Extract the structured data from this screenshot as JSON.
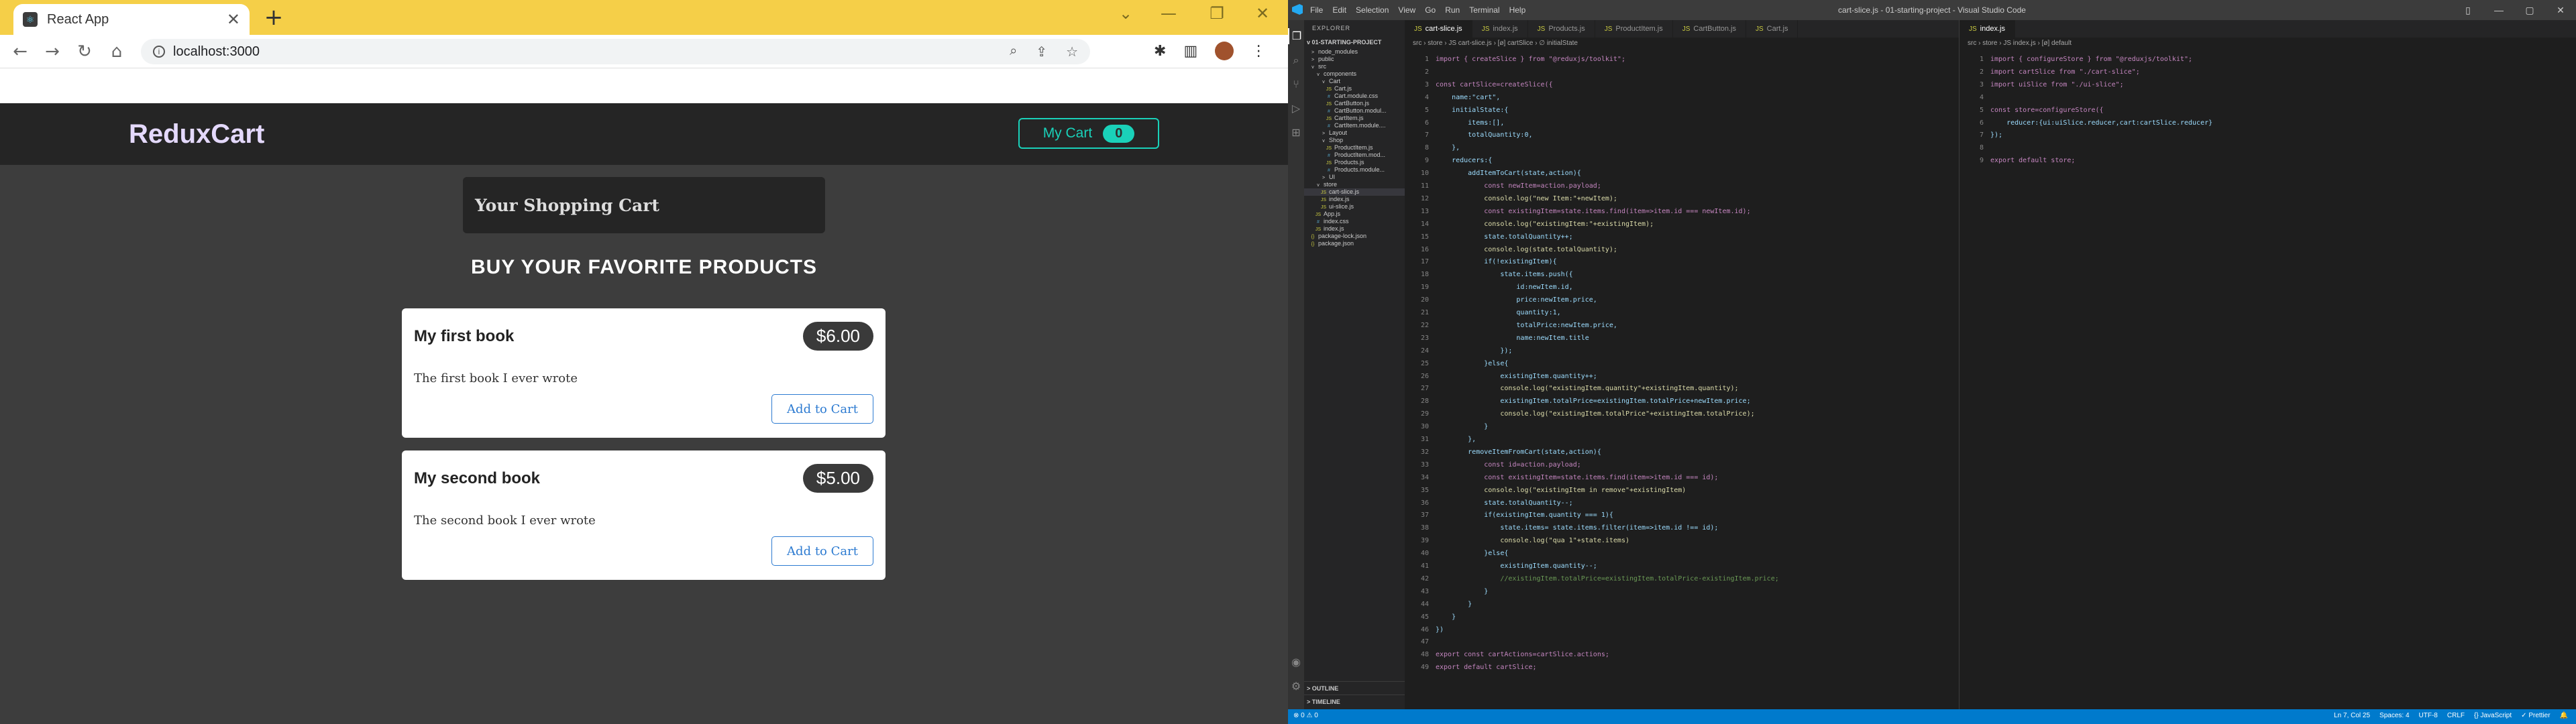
{
  "browser": {
    "tab_title": "React App",
    "url": "localhost:3000",
    "new_tab_label": "+",
    "close_label": "✕"
  },
  "app": {
    "brand": "ReduxCart",
    "cart_button_label": "My Cart",
    "cart_count": "0",
    "cart_panel_title": "Your Shopping Cart",
    "section_title": "BUY YOUR FAVORITE PRODUCTS",
    "products": [
      {
        "title": "My first book",
        "price": "$6.00",
        "description": "The first book I ever wrote",
        "button": "Add to Cart"
      },
      {
        "title": "My second book",
        "price": "$5.00",
        "description": "The second book I ever wrote",
        "button": "Add to Cart"
      }
    ]
  },
  "vscode": {
    "menu": [
      "File",
      "Edit",
      "Selection",
      "View",
      "Go",
      "Run",
      "Terminal",
      "Help"
    ],
    "window_title": "cart-slice.js - 01-starting-project - Visual Studio Code",
    "explorer_title": "EXPLORER",
    "project": "01-STARTING-PROJECT",
    "tree": [
      {
        "label": "node_modules",
        "indent": 1,
        "icon": ">"
      },
      {
        "label": "public",
        "indent": 1,
        "icon": ">"
      },
      {
        "label": "src",
        "indent": 1,
        "icon": "v"
      },
      {
        "label": "components",
        "indent": 2,
        "icon": "v"
      },
      {
        "label": "Cart",
        "indent": 3,
        "icon": "v"
      },
      {
        "label": "Cart.js",
        "indent": 4,
        "icon": "JS"
      },
      {
        "label": "Cart.module.css",
        "indent": 4,
        "icon": "#"
      },
      {
        "label": "CartButton.js",
        "indent": 4,
        "icon": "JS"
      },
      {
        "label": "CartButton.modul...",
        "indent": 4,
        "icon": "#"
      },
      {
        "label": "CartItem.js",
        "indent": 4,
        "icon": "JS"
      },
      {
        "label": "CartItem.module....",
        "indent": 4,
        "icon": "#"
      },
      {
        "label": "Layout",
        "indent": 3,
        "icon": ">"
      },
      {
        "label": "Shop",
        "indent": 3,
        "icon": "v"
      },
      {
        "label": "ProductItem.js",
        "indent": 4,
        "icon": "JS"
      },
      {
        "label": "ProductItem.mod...",
        "indent": 4,
        "icon": "#"
      },
      {
        "label": "Products.js",
        "indent": 4,
        "icon": "JS"
      },
      {
        "label": "Products.module...",
        "indent": 4,
        "icon": "#"
      },
      {
        "label": "UI",
        "indent": 3,
        "icon": ">"
      },
      {
        "label": "store",
        "indent": 2,
        "icon": "v"
      },
      {
        "label": "cart-slice.js",
        "indent": 3,
        "icon": "JS",
        "selected": true
      },
      {
        "label": "index.js",
        "indent": 3,
        "icon": "JS"
      },
      {
        "label": "ui-slice.js",
        "indent": 3,
        "icon": "JS"
      },
      {
        "label": "App.js",
        "indent": 2,
        "icon": "JS"
      },
      {
        "label": "index.css",
        "indent": 2,
        "icon": "#"
      },
      {
        "label": "index.js",
        "indent": 2,
        "icon": "JS"
      },
      {
        "label": "package-lock.json",
        "indent": 1,
        "icon": "{}"
      },
      {
        "label": "package.json",
        "indent": 1,
        "icon": "{}"
      }
    ],
    "outline_label": "OUTLINE",
    "timeline_label": "TIMELINE",
    "editor1_tabs": [
      "cart-slice.js",
      "index.js",
      "Products.js",
      "ProductItem.js",
      "CartButton.js",
      "Cart.js"
    ],
    "editor1_breadcrumb": "src › store › JS cart-slice.js › [ø] cartSlice › ∅ initialState",
    "editor2_tabs": [
      "index.js"
    ],
    "editor2_breadcrumb": "src › store › JS index.js › [ø] default",
    "code1": [
      "import { createSlice } from \"@reduxjs/toolkit\";",
      "",
      "const cartSlice=createSlice({",
      "    name:\"cart\",",
      "    initialState:{",
      "        items:[],",
      "        totalQuantity:0,",
      "    },",
      "    reducers:{",
      "        addItemToCart(state,action){",
      "            const newItem=action.payload;",
      "            console.log(\"new Item:\"+newItem);",
      "            const existingItem=state.items.find(item=>item.id === newItem.id);",
      "            console.log(\"existingItem:\"+existingItem);",
      "            state.totalQuantity++;",
      "            console.log(state.totalQuantity);",
      "            if(!existingItem){",
      "                state.items.push({",
      "                    id:newItem.id,",
      "                    price:newItem.price,",
      "                    quantity:1,",
      "                    totalPrice:newItem.price,",
      "                    name:newItem.title",
      "                });",
      "            }else{",
      "                existingItem.quantity++;",
      "                console.log(\"existingItem.quantity\"+existingItem.quantity);",
      "                existingItem.totalPrice=existingItem.totalPrice+newItem.price;",
      "                console.log(\"existingItem.totalPrice\"+existingItem.totalPrice);",
      "            }",
      "        },",
      "        removeItemFromCart(state,action){",
      "            const id=action.payload;",
      "            const existingItem=state.items.find(item=>item.id === id);",
      "            console.log(\"existingItem in remove\"+existingItem)",
      "            state.totalQuantity--;",
      "            if(existingItem.quantity === 1){",
      "                state.items= state.items.filter(item=>item.id !== id);",
      "                console.log(\"qua 1\"+state.items)",
      "            }else{",
      "                existingItem.quantity--;",
      "                //existingItem.totalPrice=existingItem.totalPrice-existingItem.price;",
      "            }",
      "        }",
      "    }",
      "})",
      "",
      "export const cartActions=cartSlice.actions;",
      "export default cartSlice;"
    ],
    "code2": [
      "import { configureStore } from \"@reduxjs/toolkit\";",
      "import cartSlice from \"./cart-slice\";",
      "import uiSlice from \"./ui-slice\";",
      "",
      "const store=configureStore({",
      "    reducer:{ui:uiSlice.reducer,cart:cartSlice.reducer}",
      "});",
      "",
      "export default store;"
    ],
    "status_left": "⊗ 0 ⚠ 0",
    "status_right": [
      "Ln 7, Col 25",
      "Spaces: 4",
      "UTF-8",
      "CRLF",
      "{} JavaScript",
      "✓ Prettier",
      "🔔"
    ],
    "colors": {
      "accent": "#007acc",
      "keyword": "#c586c0",
      "string": "#ce9178"
    }
  }
}
